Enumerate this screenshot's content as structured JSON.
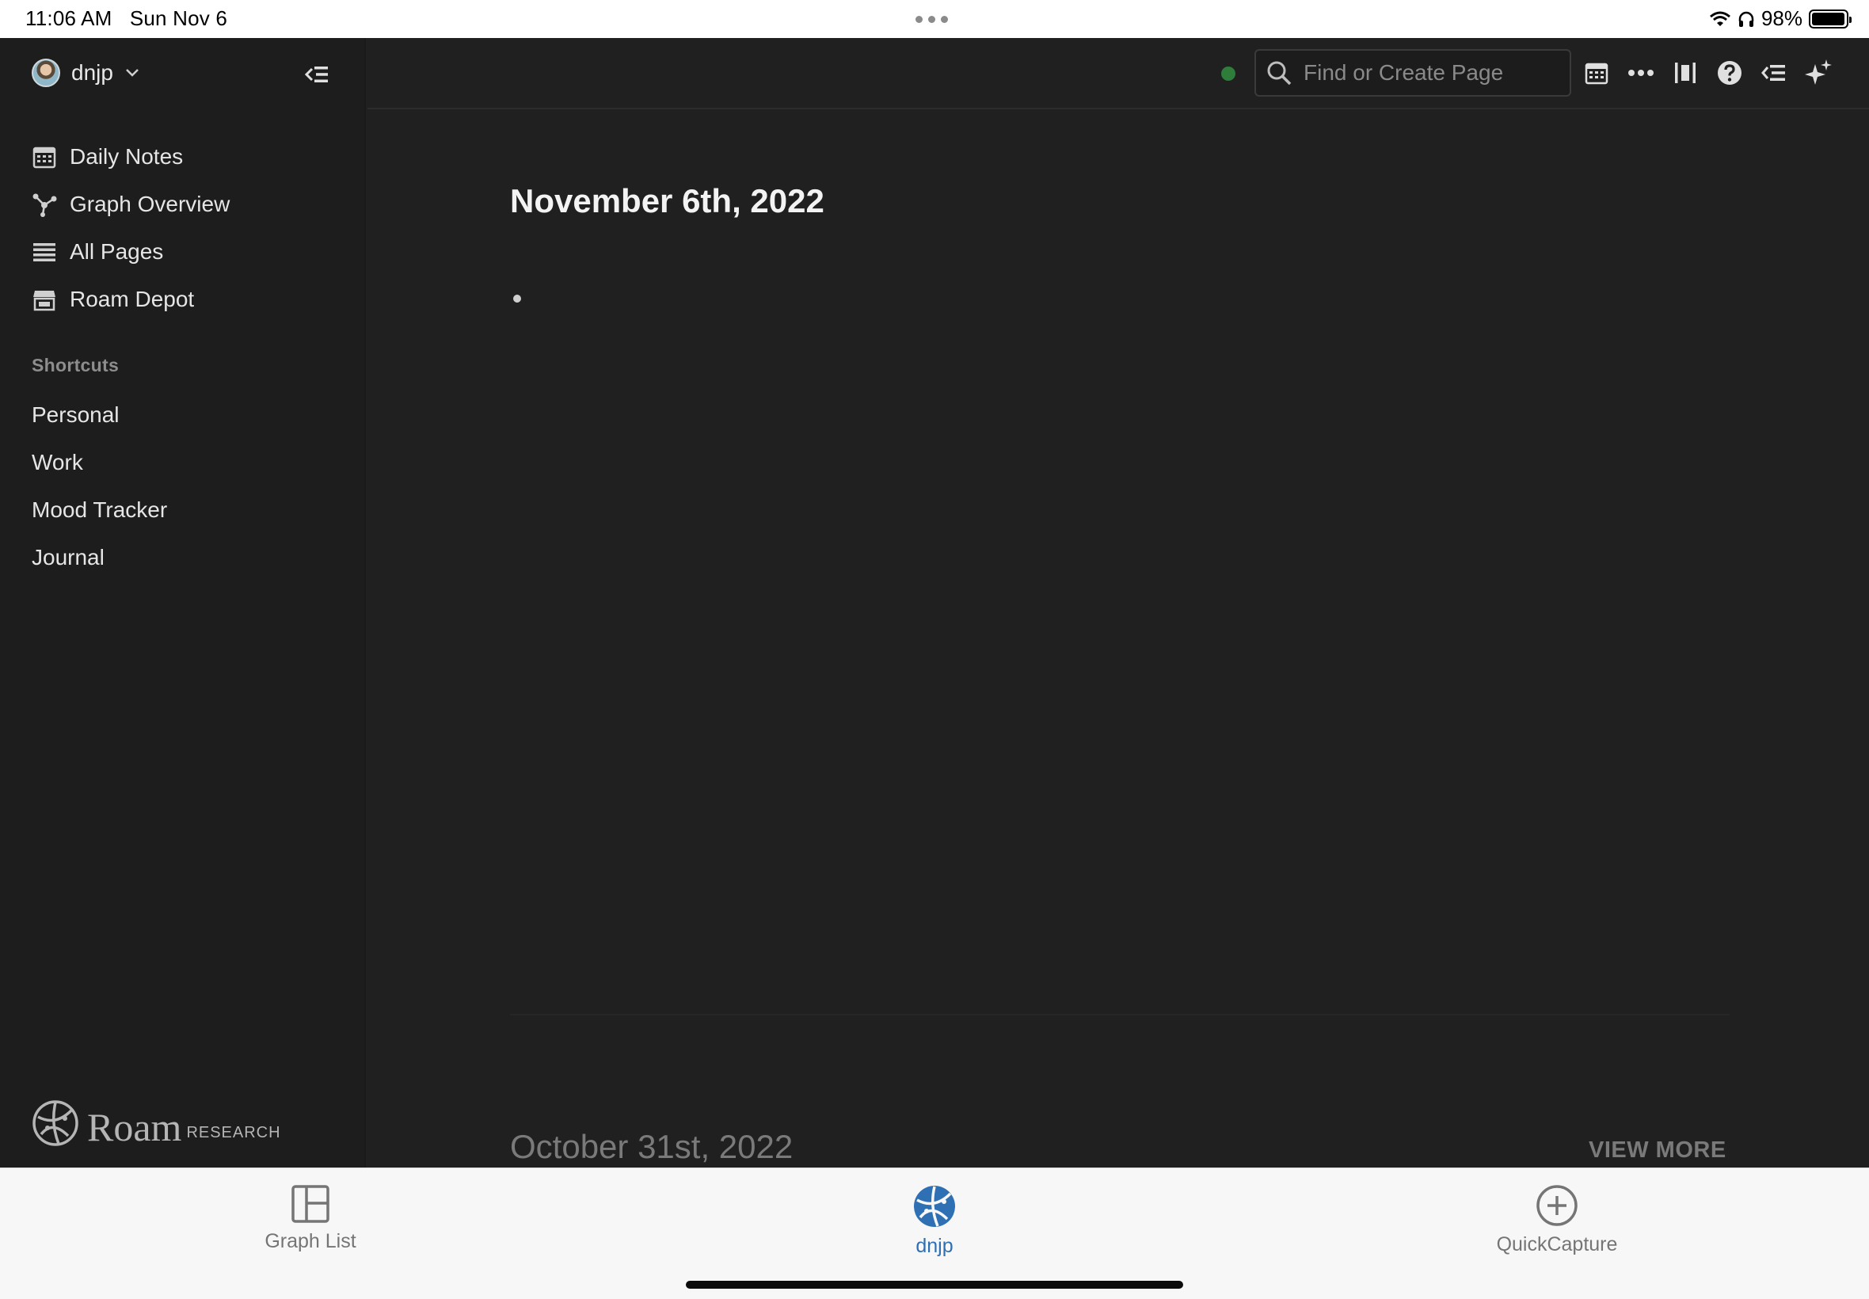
{
  "status_bar": {
    "time": "11:06 AM",
    "date": "Sun Nov 6",
    "battery_percent": "98%",
    "battery_level": 0.98
  },
  "sidebar": {
    "user": "dnjp",
    "nav": [
      {
        "label": "Daily Notes",
        "icon": "calendar-icon"
      },
      {
        "label": "Graph Overview",
        "icon": "graph-icon"
      },
      {
        "label": "All Pages",
        "icon": "list-icon"
      },
      {
        "label": "Roam Depot",
        "icon": "store-icon"
      }
    ],
    "shortcuts_heading": "Shortcuts",
    "shortcuts": [
      "Personal",
      "Work",
      "Mood Tracker",
      "Journal"
    ],
    "logo_word": "Roam",
    "logo_sub": "RESEARCH"
  },
  "topbar": {
    "search_placeholder": "Find or Create Page",
    "sync_status_color": "#2e7d3b",
    "icons": [
      "calendar-icon",
      "more-icon",
      "sidebar-icon",
      "help-icon",
      "outline-icon",
      "sparkle-icon"
    ]
  },
  "main": {
    "page_title": "November 6th, 2022",
    "previous_page_title": "October 31st, 2022",
    "view_more": "VIEW MORE"
  },
  "tabbar": {
    "tabs": [
      {
        "label": "Graph List",
        "icon": "layout-icon",
        "active": false
      },
      {
        "label": "dnjp",
        "icon": "graph-logo-icon",
        "active": true
      },
      {
        "label": "QuickCapture",
        "icon": "plus-circle-icon",
        "active": false
      }
    ],
    "active_color": "#2f6fb3"
  }
}
